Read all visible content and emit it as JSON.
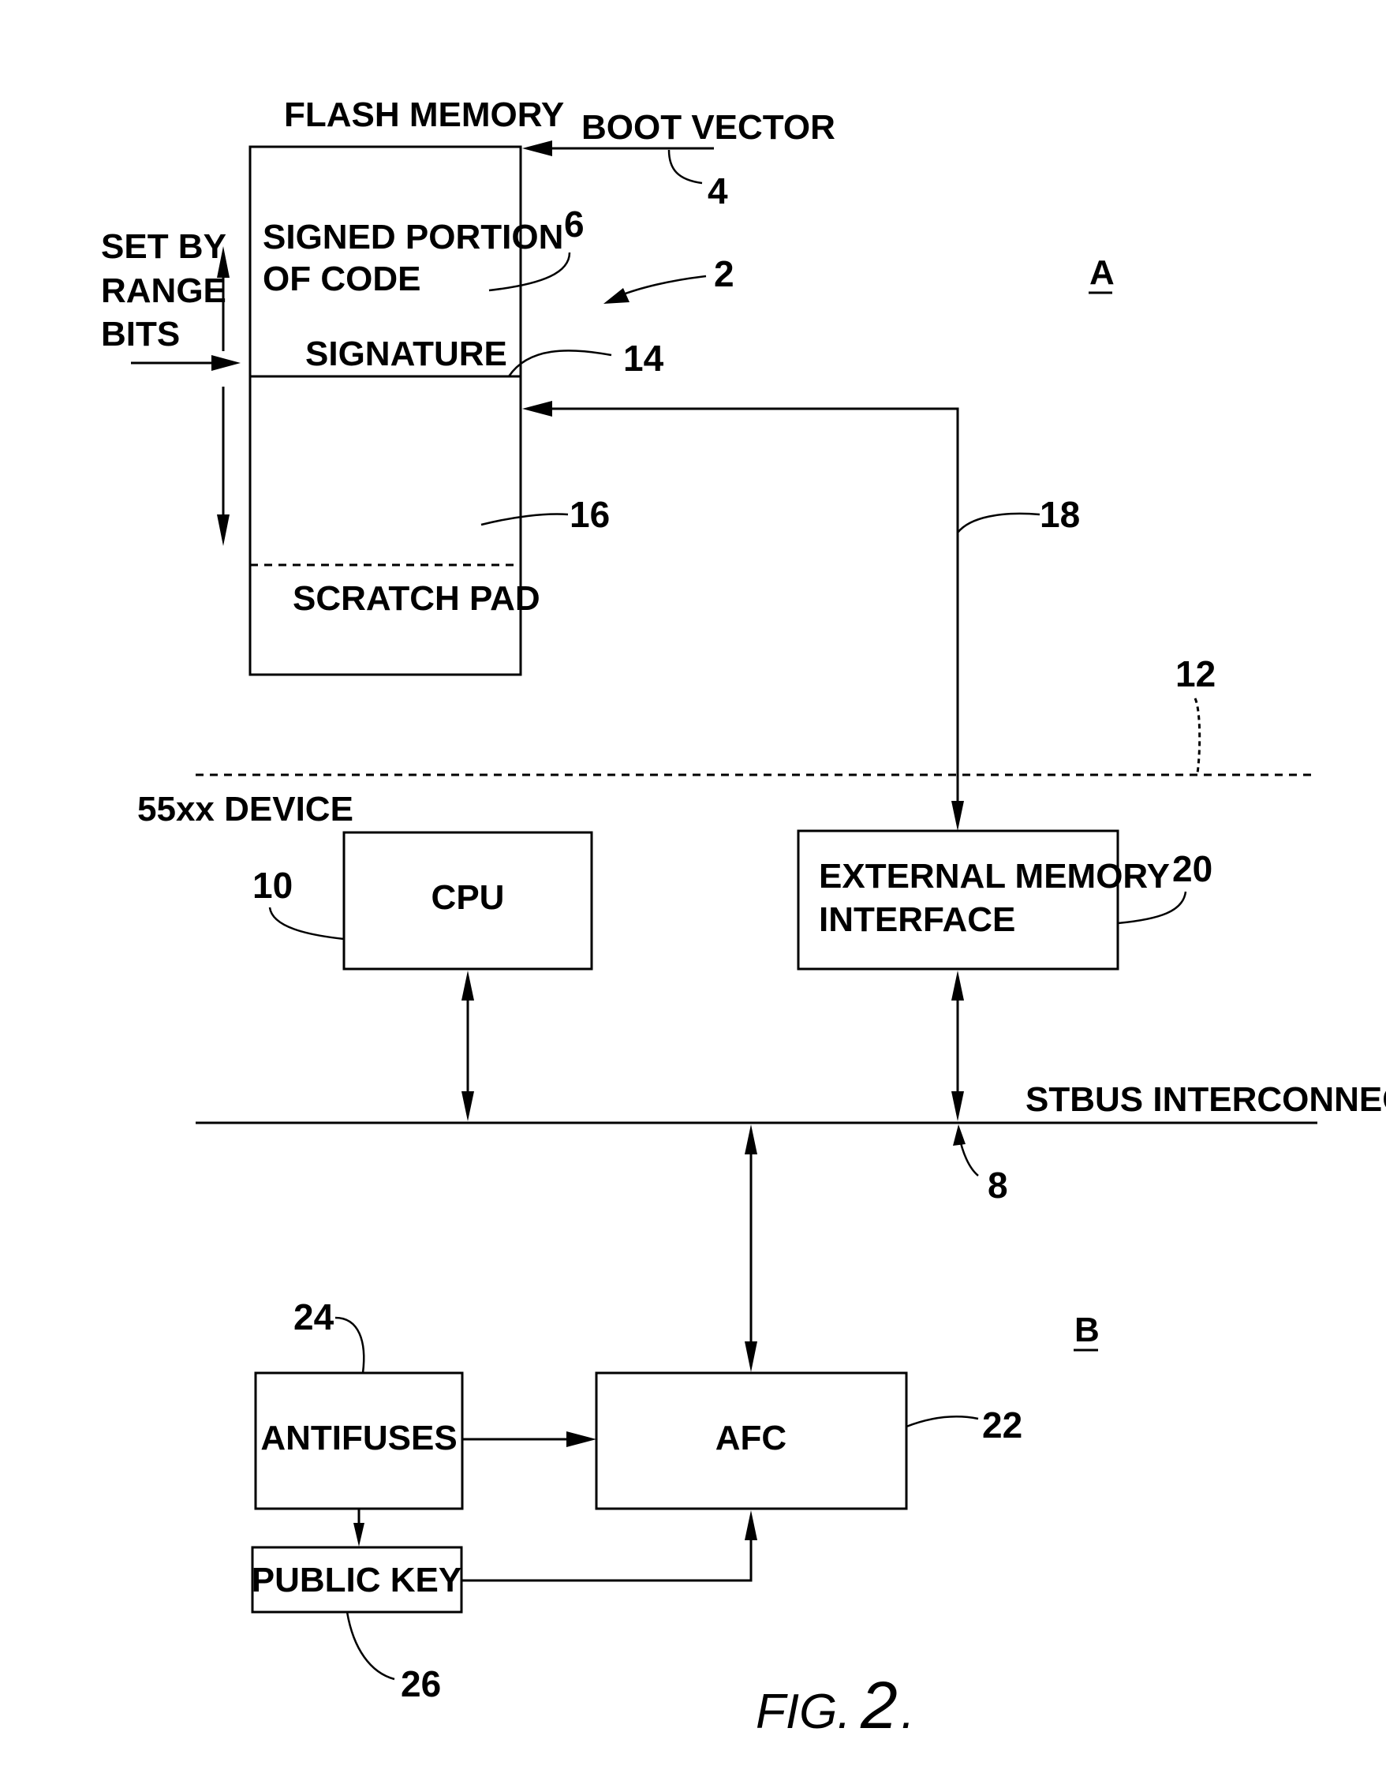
{
  "figure": {
    "caption_prefix": "FIG.",
    "caption_number": "2",
    "caption_suffix": "."
  },
  "flash_memory": {
    "title": "FLASH MEMORY",
    "signed_line1": "SIGNED PORTION",
    "signed_line2": "OF CODE",
    "signature": "SIGNATURE",
    "scratch_pad": "SCRATCH PAD"
  },
  "labels": {
    "boot_vector": "BOOT VECTOR",
    "set_by_line1": "SET BY",
    "set_by_line2": "RANGE",
    "set_by_line3": "BITS",
    "device": "55xx DEVICE",
    "region_a": "A",
    "region_b": "B",
    "bus": "STBUS INTERCONNECT"
  },
  "blocks": {
    "cpu": "CPU",
    "emi_line1": "EXTERNAL MEMORY",
    "emi_line2": "INTERFACE",
    "afc": "AFC",
    "antifuses": "ANTIFUSES",
    "public_key": "PUBLIC KEY"
  },
  "refs": {
    "r2": "2",
    "r4": "4",
    "r6": "6",
    "r8": "8",
    "r10": "10",
    "r12": "12",
    "r14": "14",
    "r16": "16",
    "r18": "18",
    "r20": "20",
    "r22": "22",
    "r24": "24",
    "r26": "26"
  }
}
